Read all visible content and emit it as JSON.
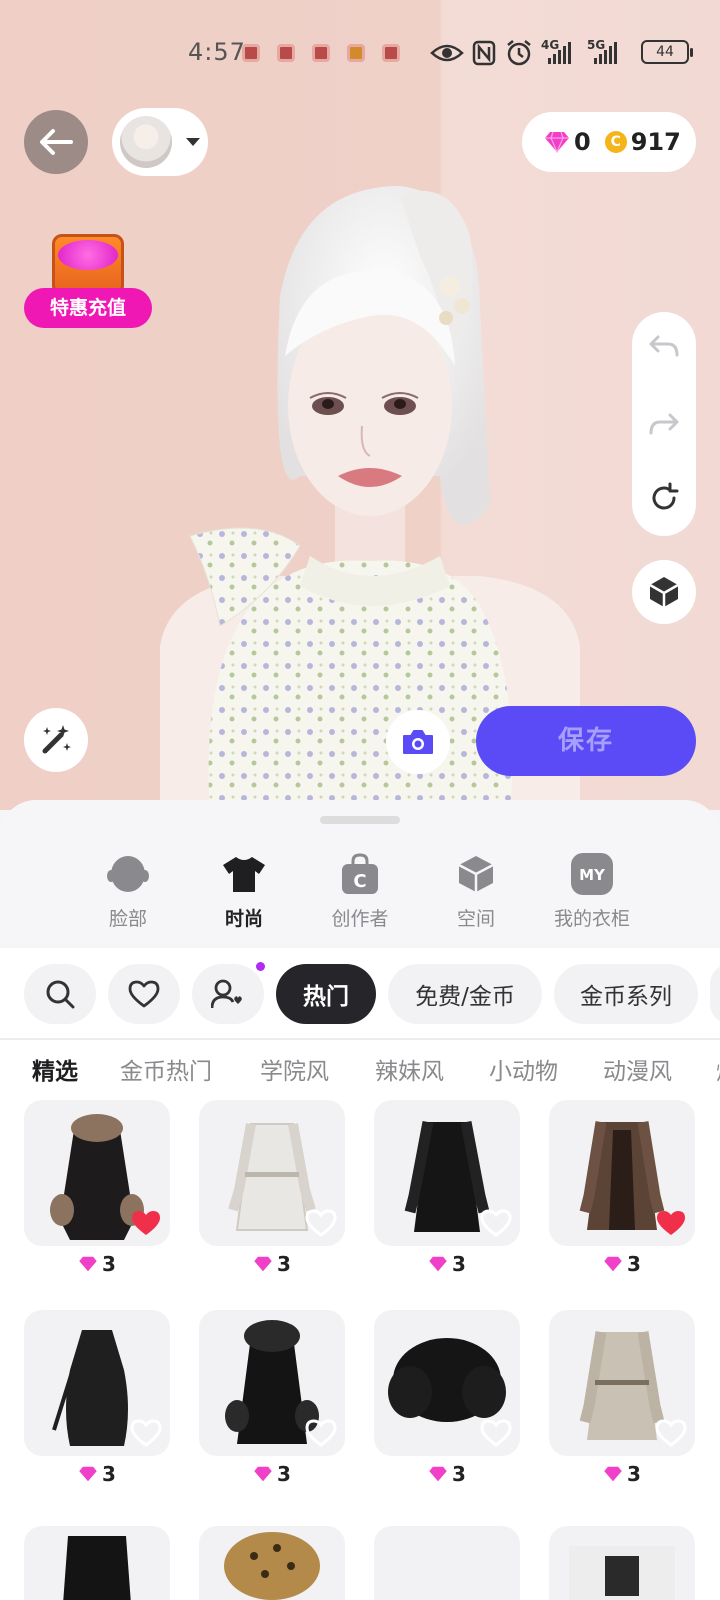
{
  "status_bar": {
    "time": "4:57",
    "net1": "4G",
    "net2": "5G",
    "battery": "44"
  },
  "wallet": {
    "gems": "0",
    "coins": "917",
    "coin_symbol": "C"
  },
  "promo": {
    "label": "特惠充值"
  },
  "actions": {
    "save_label": "保存"
  },
  "categories": [
    {
      "label": "脸部",
      "icon": "face-icon",
      "active": false
    },
    {
      "label": "时尚",
      "icon": "tshirt-icon",
      "active": true
    },
    {
      "label": "创作者",
      "icon": "creator-bag-icon",
      "active": false
    },
    {
      "label": "空间",
      "icon": "space-cube-icon",
      "active": false
    },
    {
      "label": "我的衣柜",
      "icon": "my-wardrobe-icon",
      "icon_text": "MY",
      "active": false
    }
  ],
  "chips": [
    {
      "label": "热门",
      "active": true
    },
    {
      "label": "免费/金币",
      "active": false
    },
    {
      "label": "金币系列",
      "active": false
    }
  ],
  "subtabs": [
    "精选",
    "金币热门",
    "学院风",
    "辣妹风",
    "小动物",
    "动漫风",
    "炫"
  ],
  "items": [
    {
      "price": "3",
      "favorited": true,
      "garment": "fur-cuff-black-coat"
    },
    {
      "price": "3",
      "favorited": false,
      "garment": "white-trench-coat"
    },
    {
      "price": "3",
      "favorited": false,
      "garment": "black-long-coat"
    },
    {
      "price": "3",
      "favorited": true,
      "garment": "brown-leather-coat"
    },
    {
      "price": "3",
      "favorited": false,
      "garment": "black-halter-top"
    },
    {
      "price": "3",
      "favorited": false,
      "garment": "black-fur-leather-coat"
    },
    {
      "price": "3",
      "favorited": false,
      "garment": "black-fur-jacket"
    },
    {
      "price": "3",
      "favorited": false,
      "garment": "beige-trench-coat"
    }
  ],
  "colors": {
    "accent": "#5b4bf7",
    "promo": "#f018b4",
    "gem": "#f040c8",
    "coin": "#f4b41a",
    "heart": "#f0304a"
  }
}
